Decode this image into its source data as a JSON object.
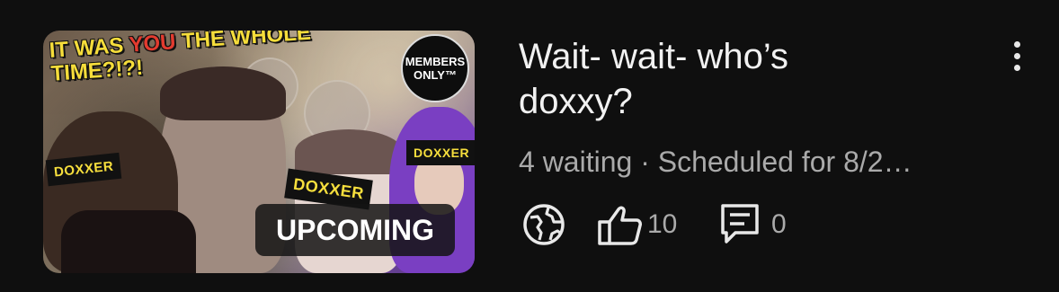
{
  "video": {
    "title_line1": "Wait- wait- who’s",
    "title_line2": "doxxy?",
    "meta": "4 waiting · Scheduled for 8/2…",
    "likes": "10",
    "comments": "0"
  },
  "thumbnail": {
    "headline_a": "IT WAS ",
    "headline_b": "YOU",
    "headline_c": " THE WHOLE",
    "headline_d": "TIME?!?!",
    "badge_1": "MEMBERS",
    "badge_2": "ONLY™",
    "tag_left": "DOXXER",
    "tag_center": "DOXXER",
    "tag_right": "DOXXER",
    "status": "UPCOMING"
  },
  "icons": {
    "visibility": "globe-icon",
    "like": "thumbs-up-icon",
    "comments": "comment-icon",
    "menu": "more-vert-icon"
  },
  "colors": {
    "background": "#0f0f0f",
    "title": "#f1f1f1",
    "secondary": "#aaaaaa",
    "headline_yellow": "#f6dd3b",
    "headline_red": "#e23b2f"
  }
}
